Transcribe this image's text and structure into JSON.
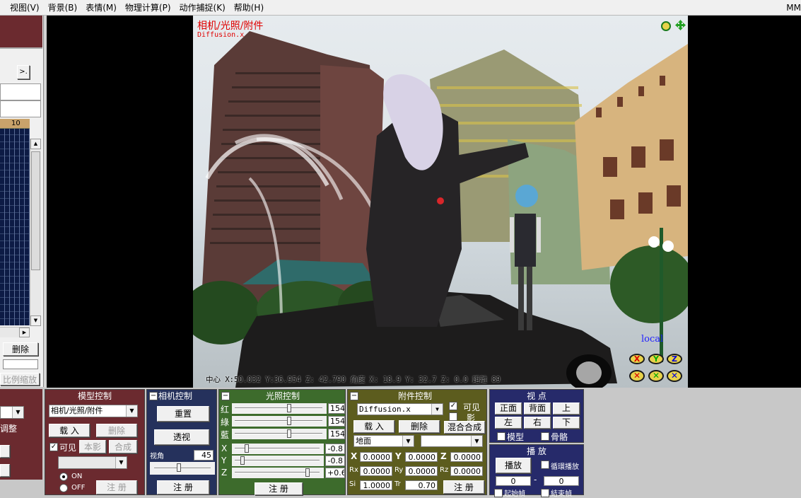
{
  "menu": {
    "items": [
      "视图(V)",
      "背景(B)",
      "表情(M)",
      "物理计算(P)",
      "动作捕捉(K)",
      "帮助(H)"
    ],
    "right_text": "MM"
  },
  "timeline": {
    "expand_label": ">.",
    "frame_label": "10",
    "delete_label": "删除",
    "scale_label": "比例缩放"
  },
  "viewport": {
    "mode_label": "相机/光照/附件",
    "accessory_label": "Diffusion.x",
    "local_label": "local",
    "status_line": "中心 X:50.032 Y:36.954 Z: 42.790  角度 X:  18.9 Y: 32.7 Z: 0.0  距離 89"
  },
  "left_panel": {
    "adjust_label": "调整",
    "on_label": "ON",
    "off_label": "OFF"
  },
  "model_panel": {
    "title": "模型控制",
    "selected": "相机/光照/附件",
    "load_label": "载 入",
    "delete_label": "删除",
    "visible_label": "可见",
    "shadow_label": "本影",
    "compose_label": "合成",
    "register_label": "注 册"
  },
  "camera_panel": {
    "title": "相机控制",
    "reset_label": "重置",
    "perspective_label": "透视",
    "fov_label": "视角",
    "fov_value": "45",
    "register_label": "注 册"
  },
  "light_panel": {
    "title": "光照控制",
    "red_label": "红",
    "green_label": "綠",
    "blue_label": "藍",
    "red_value": "154",
    "green_value": "154",
    "blue_value": "154",
    "x_label": "X",
    "y_label": "Y",
    "z_label": "Z",
    "x_value": "-0.8",
    "y_value": "-0.8",
    "z_value": "+0.6",
    "register_label": "注 册"
  },
  "accessory_panel": {
    "title": "附件控制",
    "selected": "Diffusion.x",
    "visible_label": "可见",
    "shadow_label": "影",
    "load_label": "载 入",
    "delete_label": "删除",
    "blend_label": "混合合成",
    "parent_selected": "地面",
    "x_label": "X",
    "x_value": "0.0000",
    "y_label": "Y",
    "y_value": "0.0000",
    "z_label": "Z",
    "z_value": "0.0000",
    "rx_label": "Rx",
    "rx_value": "0.0000",
    "ry_label": "Ry",
    "ry_value": "0.0000",
    "rz_label": "Rz",
    "rz_value": "0.0000",
    "si_label": "Si",
    "si_value": "1.0000",
    "tr_label": "Tr",
    "tr_value": "0.70",
    "register_label": "注 册"
  },
  "view_panel": {
    "title": "视 点",
    "front": "正面",
    "back": "背面",
    "top": "上",
    "left": "左",
    "right": "右",
    "bottom": "下",
    "model_label": "模型",
    "bone_label": "骨骼"
  },
  "play_panel": {
    "title": "播 放",
    "play_label": "播放",
    "loop_label": "循環播放",
    "start_value": "0",
    "dash": "-",
    "end_value": "0",
    "start_frame_label": "起始幀",
    "end_frame_label": "結束幀"
  },
  "colors": {
    "model_panel": "#6b2a2f",
    "camera_panel": "#25315c",
    "light_panel": "#3d6b2c",
    "accessory_panel": "#5c5c1e",
    "view_panel": "#262a6a",
    "timeline_grid": "#0d1b45",
    "frame_header": "#c9a36b"
  }
}
